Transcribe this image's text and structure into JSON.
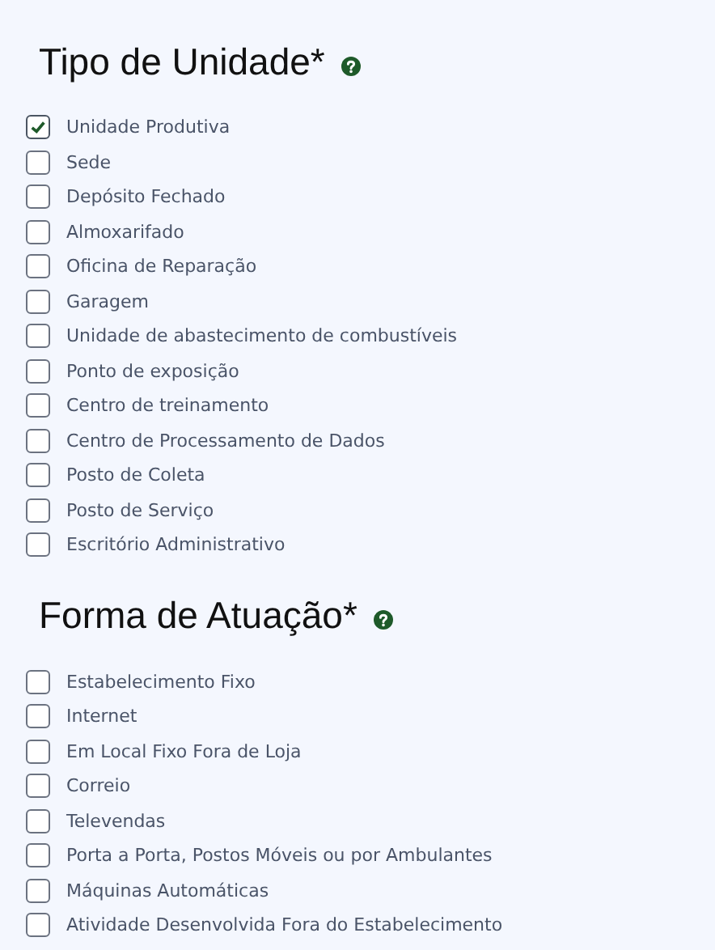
{
  "sections": [
    {
      "title": "Tipo de Unidade*",
      "options": [
        {
          "label": "Unidade Produtiva",
          "checked": true
        },
        {
          "label": "Sede",
          "checked": false
        },
        {
          "label": "Depósito Fechado",
          "checked": false
        },
        {
          "label": "Almoxarifado",
          "checked": false
        },
        {
          "label": "Oficina de Reparação",
          "checked": false
        },
        {
          "label": "Garagem",
          "checked": false
        },
        {
          "label": "Unidade de abastecimento de combustíveis",
          "checked": false
        },
        {
          "label": "Ponto de exposição",
          "checked": false
        },
        {
          "label": "Centro de treinamento",
          "checked": false
        },
        {
          "label": "Centro de Processamento de Dados",
          "checked": false
        },
        {
          "label": "Posto de Coleta",
          "checked": false
        },
        {
          "label": "Posto de Serviço",
          "checked": false
        },
        {
          "label": "Escritório Administrativo",
          "checked": false
        }
      ]
    },
    {
      "title": "Forma de Atuação*",
      "options": [
        {
          "label": "Estabelecimento Fixo",
          "checked": false
        },
        {
          "label": "Internet",
          "checked": false
        },
        {
          "label": "Em Local Fixo Fora de Loja",
          "checked": false
        },
        {
          "label": "Correio",
          "checked": false
        },
        {
          "label": "Televendas",
          "checked": false
        },
        {
          "label": "Porta a Porta, Postos Móveis ou por Ambulantes",
          "checked": false
        },
        {
          "label": "Máquinas Automáticas",
          "checked": false
        },
        {
          "label": "Atividade Desenvolvida Fora do Estabelecimento",
          "checked": false
        }
      ]
    }
  ]
}
